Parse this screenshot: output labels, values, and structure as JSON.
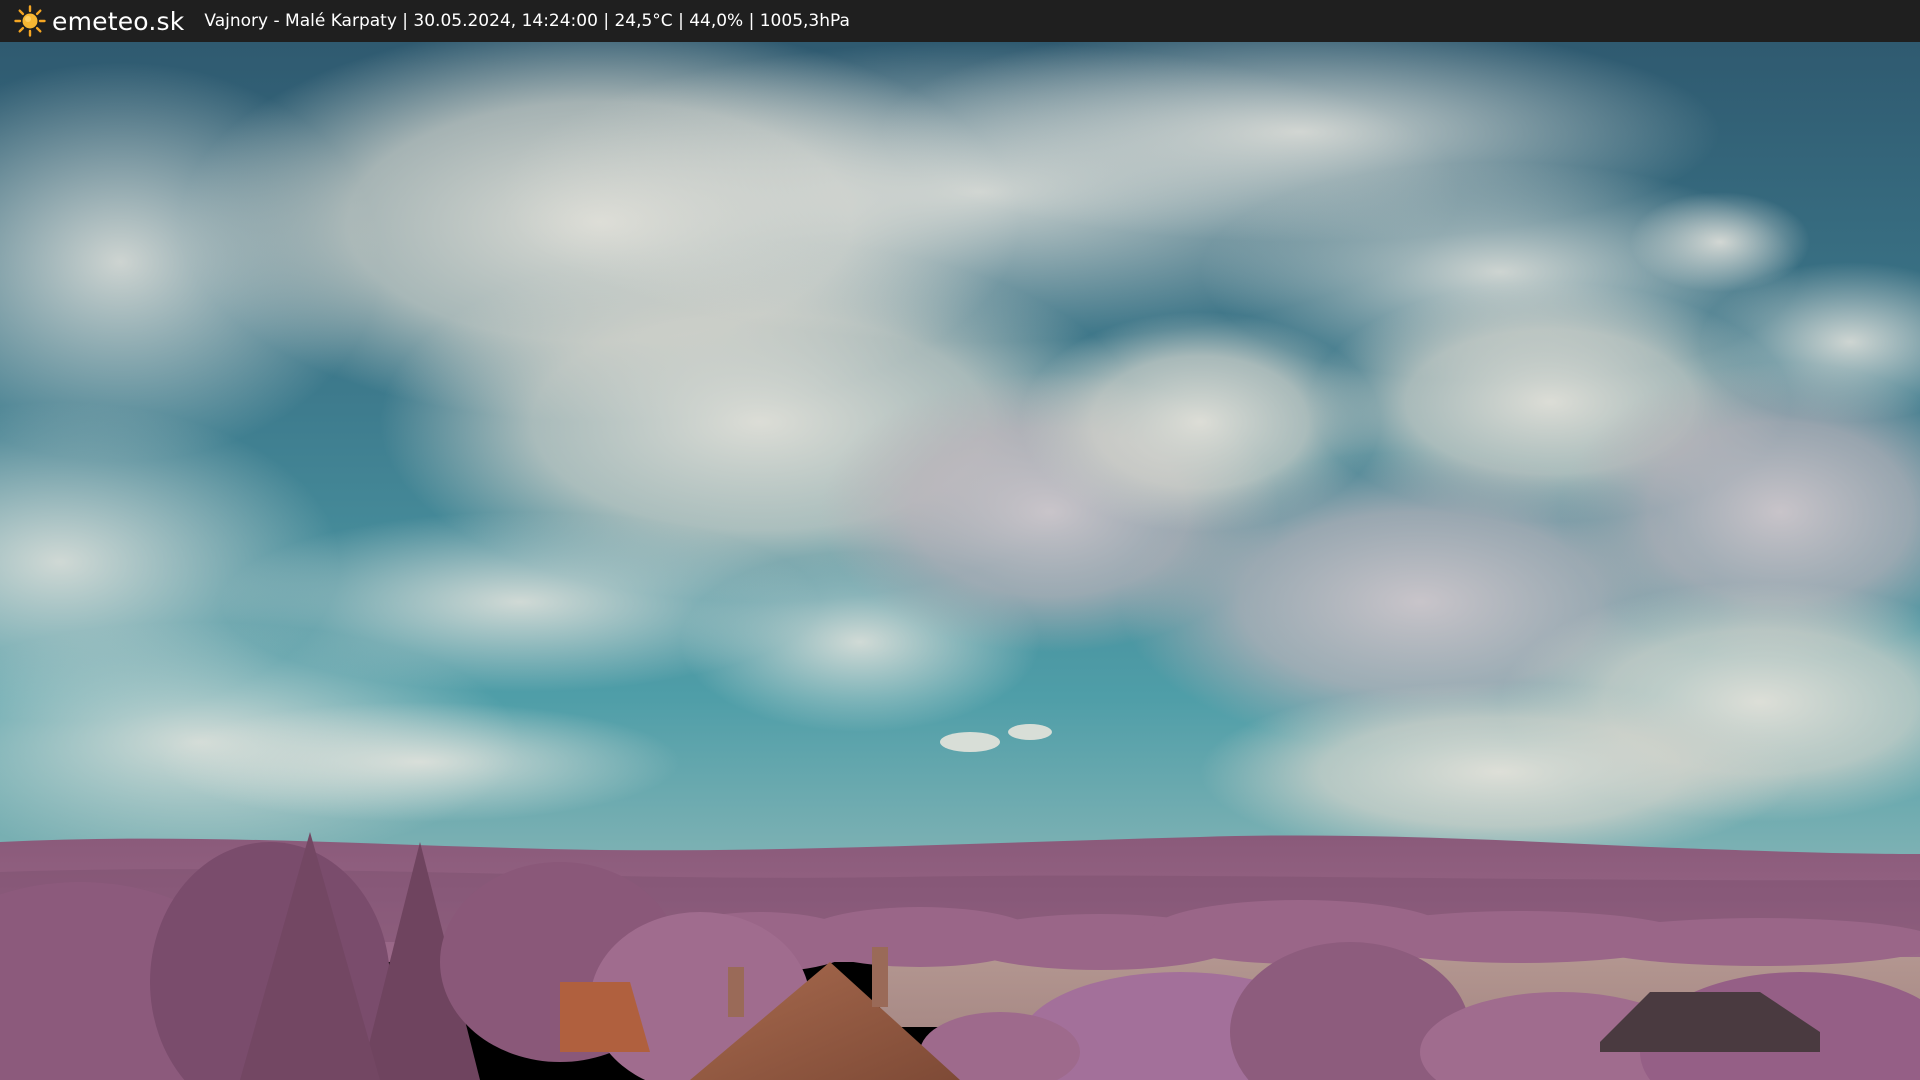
{
  "header": {
    "brand": "emeteo.sk",
    "caption": "Vajnory - Malé Karpaty | 30.05.2024, 14:24:00 | 24,5°C | 44,0% | 1005,3hPa",
    "logo_icon": "sun-icon"
  },
  "colors": {
    "bar": "#1f1f1f",
    "sun": "#f5a623",
    "sky_top": "#2f5f74",
    "sky_low": "#4d9aa6",
    "cloud": "#d9d8d0",
    "hills": "#8e5e7e",
    "foliage": "#a06a8e",
    "field": "#b89a92",
    "roof": "#b0603e"
  }
}
